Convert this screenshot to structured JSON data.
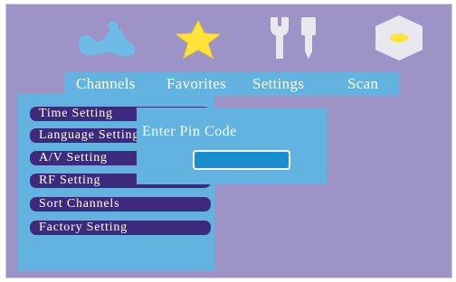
{
  "menu": {
    "tabs": [
      {
        "label": "Channels",
        "icon": "satellite-dish-icon"
      },
      {
        "label": "Favorites",
        "icon": "star-icon"
      },
      {
        "label": "Settings",
        "icon": "wrench-screwdriver-icon"
      },
      {
        "label": "Scan",
        "icon": "hexagon-scan-icon"
      }
    ],
    "selected": "Settings"
  },
  "settings_menu": {
    "items": [
      {
        "label": "Time Setting"
      },
      {
        "label": "Language Setting"
      },
      {
        "label": "A/V Setting"
      },
      {
        "label": "RF Setting"
      },
      {
        "label": "Sort Channels"
      },
      {
        "label": "Factory Setting"
      }
    ]
  },
  "pin_dialog": {
    "title": "Enter Pin Code",
    "value": ""
  },
  "colors": {
    "background": "#9d93c7",
    "panel": "#63b3e0",
    "item": "#3d2a7c",
    "input": "#1a8fd0",
    "star": "#ffe33a"
  }
}
